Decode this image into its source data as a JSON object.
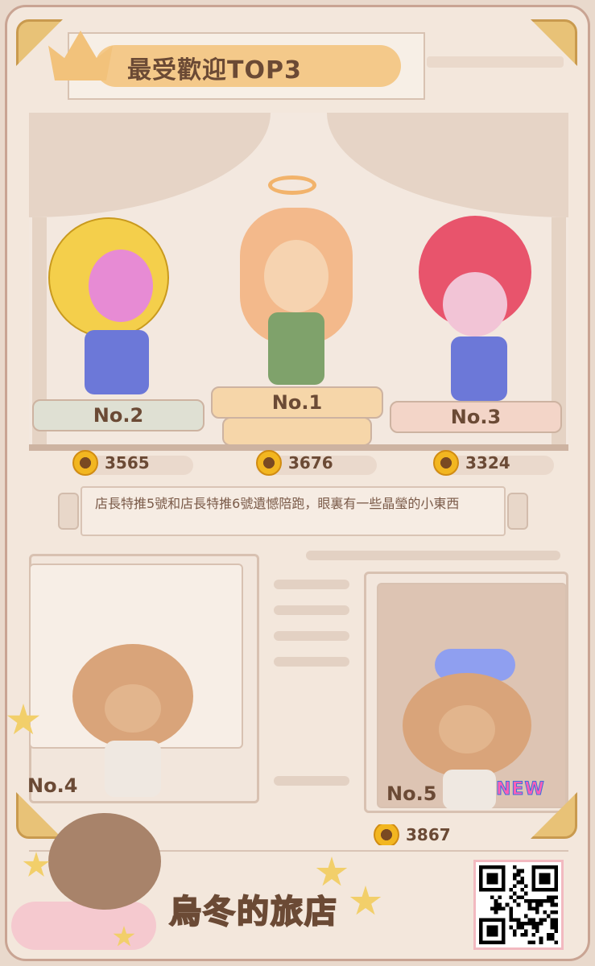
{
  "header": {
    "title": "最受歡迎TOP3"
  },
  "podiums": [
    {
      "rank_label": "No.2",
      "score": "3565"
    },
    {
      "rank_label": "No.1",
      "score": "3676"
    },
    {
      "rank_label": "No.3",
      "score": "3324"
    }
  ],
  "note": {
    "text": "店長特推5號和店長特推6號遺憾陪跑，眼裏有一些晶瑩的小東西"
  },
  "lower": {
    "no4_label": "No.4",
    "no5_label": "No.5",
    "new_badge": "NEW",
    "no5_score_partial": "3867"
  },
  "footer": {
    "logo_text": "烏冬的旅店"
  },
  "colors": {
    "accent": "#f4c98a",
    "frame": "#c9a493",
    "text": "#6b4a35",
    "new_badge": "#ff5fb6"
  }
}
